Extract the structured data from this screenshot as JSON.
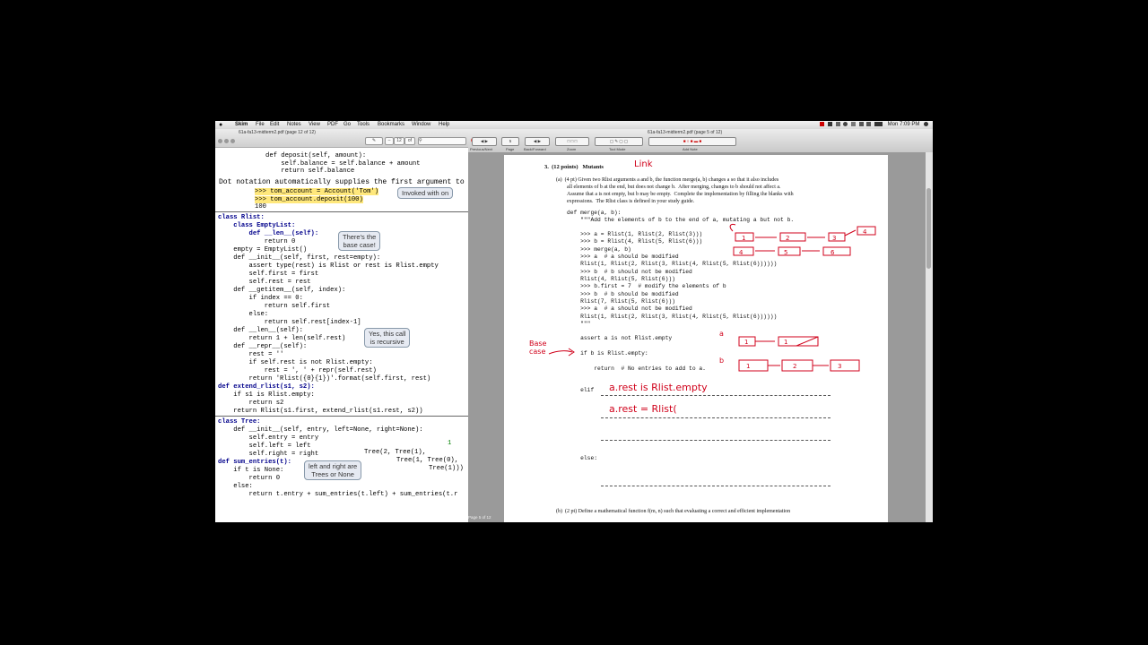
{
  "menubar": {
    "apple": "",
    "items": [
      "Skim",
      "File",
      "Edit",
      "Notes",
      "View",
      "PDF",
      "Go",
      "Tools",
      "Bookmarks",
      "Window",
      "Help"
    ],
    "clock": "Mon 7:09 PM"
  },
  "left_window": {
    "title": "61a-fa13-midterm2.pdf (page 12 of 12)",
    "page_field": "12",
    "toolbar_of": "of"
  },
  "code": {
    "l01": "def deposit(self, amount):",
    "l02": "    self.balance = self.balance + amount",
    "l03": "    return self.balance",
    "l04": "Dot notation automatically supplies the first argument to a m",
    "l05": ">>> tom_account = Account('Tom')",
    "l06": ">>> tom_account.deposit(100)",
    "l07": "100",
    "c01": "class Rlist:",
    "c02": "    class EmptyList:",
    "c03": "        def __len__(self):",
    "c04": "            return 0",
    "c05": "    empty = EmptyList()",
    "c06": "    def __init__(self, first, rest=empty):",
    "c07": "        assert type(rest) is Rlist or rest is Rlist.empty",
    "c08": "        self.first = first",
    "c09": "        self.rest = rest",
    "c10": "    def __getitem__(self, index):",
    "c11": "        if index == 0:",
    "c12": "            return self.first",
    "c13": "        else:",
    "c14": "            return self.rest[index-1]",
    "c15": "    def __len__(self):",
    "c16": "        return 1 + len(self.rest)",
    "c17": "    def __repr__(self):",
    "c18": "        rest = ''",
    "c19": "        if self.rest is not Rlist.empty:",
    "c20": "            rest = ', ' + repr(self.rest)",
    "c21": "        return 'Rlist({0}{1})'.format(self.first, rest)",
    "c22": "def extend_rlist(s1, s2):",
    "c23": "    if s1 is Rlist.empty:",
    "c24": "        return s2",
    "c25": "    return Rlist(s1.first, extend_rlist(s1.rest, s2))",
    "t01": "class Tree:",
    "t02": "    def __init__(self, entry, left=None, right=None):",
    "t03": "        self.entry = entry",
    "t04": "        self.left = left",
    "t05": "        self.right = right",
    "t06": "def sum_entries(t):",
    "t07": "    if t is None:",
    "t08": "        return 0",
    "t09": "    else:",
    "t10": "        return t.entry + sum_entries(t.left) + sum_entries(t.r",
    "tree_a": "Tree(2, Tree(1),",
    "tree_b": "Tree(1, Tree(0),",
    "tree_c": "Tree(1)))",
    "tree_num": "1"
  },
  "bubbles": {
    "invoked": "Invoked with on",
    "base_case": "There's the\nbase case!",
    "recursive": "Yes, this call\nis recursive",
    "left_right": "left and right are\nTrees or None"
  },
  "right_window": {
    "title": "61a-fa13-midterm2.pdf (page 5 of 12)",
    "page_field": "5",
    "labels": [
      "Previous/Next",
      "Page",
      "Back/Forward",
      "Zoom",
      "Tool Mode",
      "Add Note"
    ],
    "status": "Page 5 of 12"
  },
  "pdf": {
    "heading": "3.  (12 points)   Mutants",
    "part_a_1": "(a)  (4 pt) Given two Rlist arguments a and b, the function merge(a, b) changes a so that it also includes",
    "part_a_2": "all elements of b at the end, but does not change b.  After merging, changes to b should not affect a.",
    "part_a_3": "Assume that a is not empty, but b may be empty.  Complete the implementation by filling the blanks with",
    "part_a_4": "expressions.  The Rlist class is defined in your study guide.",
    "m01": "def merge(a, b):",
    "m02": "    \"\"\"Add the elements of b to the end of a, mutating a but not b.",
    "m03": "    >>> a = Rlist(1, Rlist(2, Rlist(3)))",
    "m04": "    >>> b = Rlist(4, Rlist(5, Rlist(6)))",
    "m05": "    >>> merge(a, b)",
    "m06": "    >>> a  # a should be modified",
    "m07": "    Rlist(1, Rlist(2, Rlist(3, Rlist(4, Rlist(5, Rlist(6))))))",
    "m08": "    >>> b  # b should not be modified",
    "m09": "    Rlist(4, Rlist(5, Rlist(6)))",
    "m10": "    >>> b.first = 7  # modify the elements of b",
    "m11": "    >>> b  # b should be modified",
    "m12": "    Rlist(7, Rlist(5, Rlist(6)))",
    "m13": "    >>> a  # a should not be modified",
    "m14": "    Rlist(1, Rlist(2, Rlist(3, Rlist(4, Rlist(5, Rlist(6))))))",
    "m15": "    \"\"\"",
    "m16": "    assert a is not Rlist.empty",
    "m17": "    if b is Rlist.empty:",
    "m18": "        return  # No entries to add to a.",
    "m19": "    elif",
    "m20": "    else:",
    "part_b": "(b)  (2 pt) Define a mathematical function f(m, n) such that evaluating a correct and efficient implementation"
  },
  "handwriting": {
    "link": "Link",
    "base_case": "Base\ncase",
    "elif_answer": "a.rest is Rlist.empty",
    "line2": "a.rest = Rlist(",
    "a_label": "a",
    "b_label": "b",
    "a1": "1",
    "a2": "1",
    "b1": "1",
    "b2": "2",
    "b3": "3",
    "r1a": "1",
    "r1b": "2",
    "r1c": "3",
    "r1d": "4",
    "r2a": "4",
    "r2b": "5",
    "r2c": "6"
  },
  "colors": {
    "ink": "#d0021b",
    "keyword": "#00008b",
    "bubble": "#e6eaf2"
  }
}
